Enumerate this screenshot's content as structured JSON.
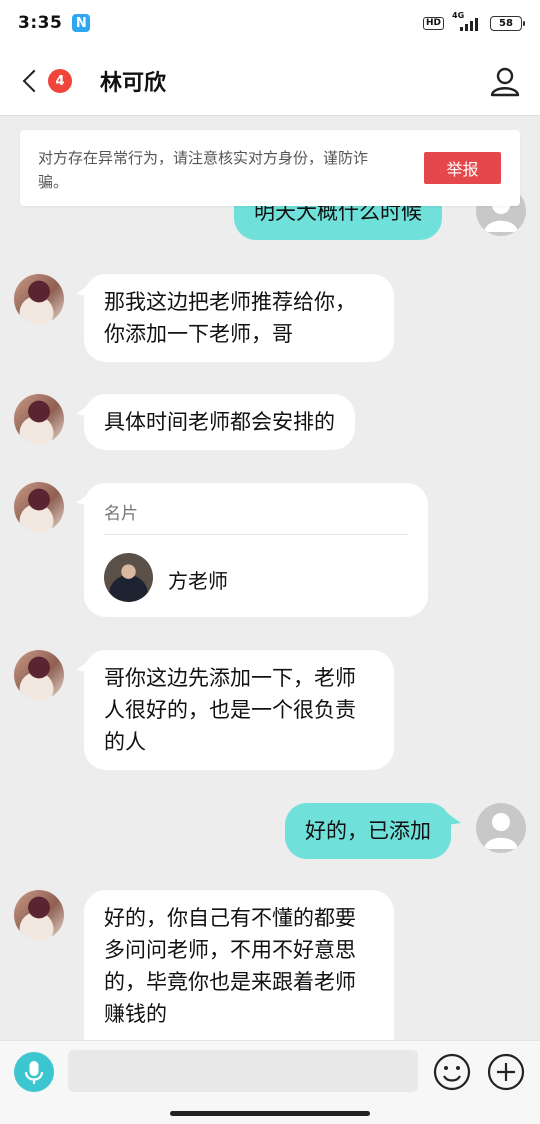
{
  "status_bar": {
    "time": "3:35",
    "app_icon_letter": "N",
    "hd_label": "HD",
    "network_label": "4G",
    "battery": "58"
  },
  "header": {
    "unread_count": "4",
    "contact_name": "林可欣"
  },
  "warning": {
    "text": "对方存在异常行为，请注意核实对方身份，谨防诈骗。",
    "report_label": "举报"
  },
  "messages": [
    {
      "side": "out",
      "text": "明天大概什么时候"
    },
    {
      "side": "in",
      "text": "那我这边把老师推荐给你，你添加一下老师，哥"
    },
    {
      "side": "in",
      "text": "具体时间老师都会安排的"
    },
    {
      "side": "in",
      "type": "card",
      "label": "名片",
      "name": "方老师"
    },
    {
      "side": "in",
      "text": "哥你这边先添加一下，老师人很好的，也是一个很负责的人"
    },
    {
      "side": "out",
      "text": "好的，已添加"
    },
    {
      "side": "in",
      "text": "好的，你自己有不懂的都要多问问老师，不用不好意思的，毕竟你也是来跟着老师赚钱的"
    }
  ],
  "input_bar": {
    "placeholder": ""
  },
  "colors": {
    "outgoing_bubble": "#6fe0da",
    "report_button": "#e5484a",
    "unread_badge": "#f0453a",
    "mic_button": "#3cc6d0"
  }
}
